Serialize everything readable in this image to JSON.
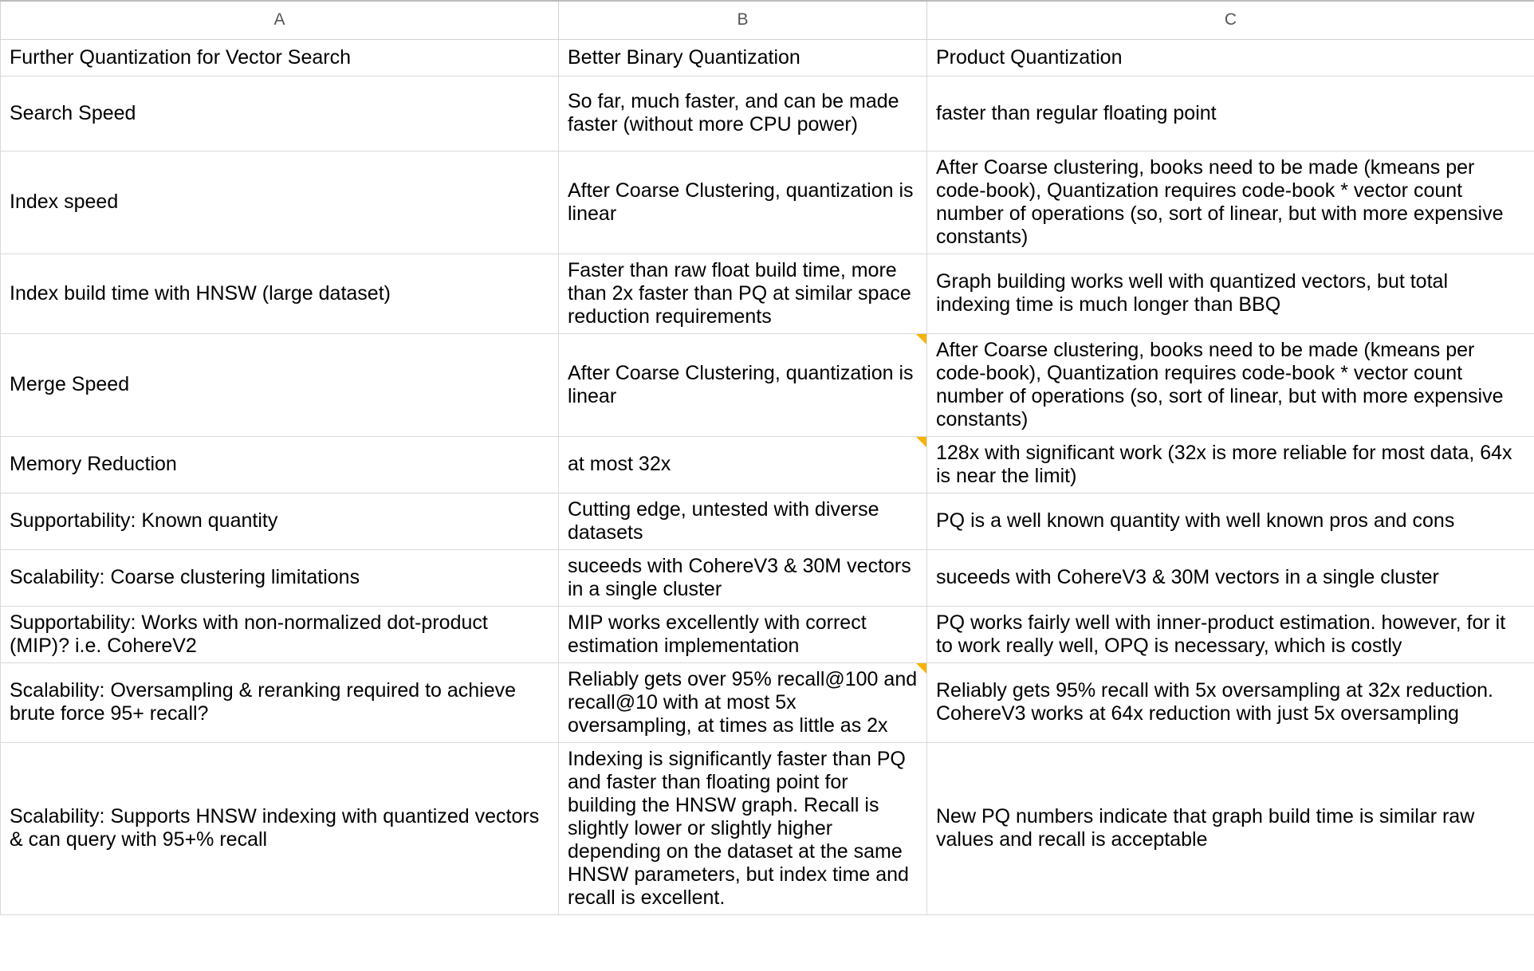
{
  "app": {
    "type": "spreadsheet",
    "column_headers": [
      "A",
      "B",
      "C"
    ]
  },
  "colors": {
    "good": "#b6d7a8",
    "neutral": "#ffe599",
    "bad": "#f9cb9c",
    "plain": "#ffffff",
    "note_marker": "#f5b400",
    "gridline": "#d9d9d9",
    "header_text": "#555555"
  },
  "table": {
    "headers": {
      "a": "Further Quantization for Vector Search",
      "b": "Better Binary Quantization",
      "c": "Product Quantization"
    },
    "rows": [
      {
        "label": "Search Speed",
        "b": {
          "text": "So far, much faster, and can be made faster (without more CPU power)",
          "fill": "green",
          "note": false
        },
        "c": {
          "text": "faster than regular floating point",
          "fill": "yellow",
          "note": false
        }
      },
      {
        "label": "Index speed",
        "b": {
          "text": "After Coarse Clustering, quantization is linear",
          "fill": "green",
          "note": false
        },
        "c": {
          "text": "After Coarse clustering, books need to be made (kmeans per code-book), Quantization requires code-book * vector count number of operations (so, sort of linear, but with more expensive constants)",
          "fill": "orange",
          "note": false
        }
      },
      {
        "label": "Index build time with HNSW (large dataset)",
        "b": {
          "text": "Faster than raw float build time, more than 2x faster than PQ at similar space reduction requirements",
          "fill": "green",
          "note": false
        },
        "c": {
          "text": "Graph building works well with quantized vectors, but total indexing time is much longer than BBQ",
          "fill": "yellow",
          "note": false
        }
      },
      {
        "label": "Merge Speed",
        "b": {
          "text": "After Coarse Clustering, quantization is linear",
          "fill": "green",
          "note": true
        },
        "c": {
          "text": "After Coarse clustering, books need to be made (kmeans per code-book), Quantization requires code-book * vector count number of operations (so, sort of linear, but with more expensive constants)",
          "fill": "orange",
          "note": false
        }
      },
      {
        "label": "Memory Reduction",
        "b": {
          "text": "at most 32x",
          "fill": "yellow",
          "note": true
        },
        "c": {
          "text": "128x with significant work (32x is more reliable for most data, 64x is near the limit)",
          "fill": "green",
          "note": false
        }
      },
      {
        "label": "Supportability: Known quantity",
        "b": {
          "text": "Cutting edge, untested with diverse datasets",
          "fill": "orange",
          "note": false
        },
        "c": {
          "text": "PQ is a well known quantity with well known pros and cons",
          "fill": "green",
          "note": false
        }
      },
      {
        "label": "Scalability: Coarse clustering limitations",
        "b": {
          "text": "suceeds with CohereV3 & 30M vectors in a single cluster",
          "fill": "green",
          "note": false
        },
        "c": {
          "text": "suceeds with CohereV3 & 30M vectors in a single cluster",
          "fill": "green",
          "note": false
        }
      },
      {
        "label": "Supportability: Works with non-normalized dot-product (MIP)? i.e. CohereV2",
        "b": {
          "text": "MIP works excellently with correct estimation implementation",
          "fill": "green",
          "note": false
        },
        "c": {
          "text": "PQ works fairly well with inner-product estimation. however, for it to work really well, OPQ is necessary, which is costly",
          "fill": "yellow",
          "note": false
        }
      },
      {
        "label": "Scalability: Oversampling & reranking required to achieve brute force 95+ recall?",
        "b": {
          "text": "Reliably gets over 95% recall@100 and recall@10 with at most 5x oversampling, at times as little as 2x",
          "fill": "green",
          "note": true
        },
        "c": {
          "text": "Reliably gets 95% recall with 5x oversampling at 32x reduction. CohereV3 works at 64x reduction with just 5x oversampling",
          "fill": "green",
          "note": false
        }
      },
      {
        "label": "Scalability: Supports HNSW indexing with quantized vectors & can query with 95+% recall",
        "b": {
          "text": "Indexing is significantly faster than PQ and faster than floating point for building the HNSW graph. Recall is slightly lower or slightly higher depending on the dataset at the same HNSW parameters, but index time and recall is excellent.",
          "fill": "green",
          "note": false
        },
        "c": {
          "text": "New PQ numbers indicate that graph build time is similar raw values and recall is acceptable",
          "fill": "yellow",
          "note": false
        }
      }
    ]
  }
}
